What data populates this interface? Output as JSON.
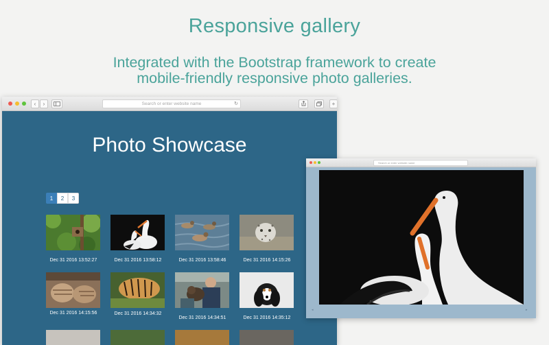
{
  "headline": "Responsive gallery",
  "subline_1": "Integrated with the Bootstrap framework to create",
  "subline_2": "mobile-friendly responsive photo galleries.",
  "browser": {
    "address_placeholder": "Search or enter website name",
    "page_title": "Photo Showcase",
    "pagination": [
      "1",
      "2",
      "3"
    ],
    "active_page": "1",
    "photos": [
      {
        "icon": "bird-on-branch-photo",
        "caption": "Dec 31 2016 13:52:27"
      },
      {
        "icon": "storks-photo",
        "caption": "Dec 31 2016 13:58:12"
      },
      {
        "icon": "ducks-photo",
        "caption": "Dec 31 2016 13:58:46"
      },
      {
        "icon": "snow-leopard-photo",
        "caption": "Dec 31 2016 14:15:26"
      },
      {
        "icon": "cat-paws-photo",
        "caption": "Dec 31 2016 14:15:56"
      },
      {
        "icon": "tiger-photo",
        "caption": "Dec 31 2016 14:34:32"
      },
      {
        "icon": "person-with-dog-photo",
        "caption": "Dec 31 2016 14:34:51"
      },
      {
        "icon": "spaniel-dog-photo",
        "caption": "Dec 31 2016 14:35:12"
      }
    ]
  },
  "lightbox": {
    "address_placeholder": "Search or enter website name",
    "image_icon": "storks-photo"
  },
  "colors": {
    "accent": "#4aa39a",
    "page_bg": "#2d6687",
    "lightbox_bg": "#9db8cc",
    "active_page": "#3b7fb8"
  }
}
